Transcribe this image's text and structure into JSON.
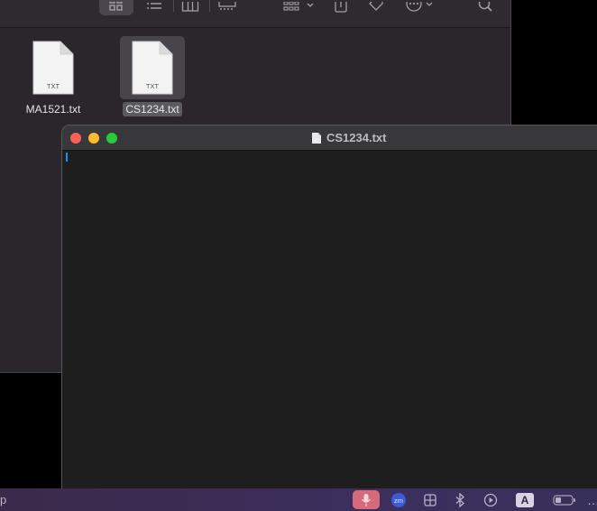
{
  "finder": {
    "toolbar_icons": [
      "icon-view-icon",
      "list-view-icon",
      "column-view-icon",
      "gallery-view-icon",
      "group-icon",
      "share-icon",
      "tag-icon",
      "more-icon",
      "search-icon"
    ],
    "files": [
      {
        "name": "MA1521.txt",
        "badge": "TXT",
        "selected": false
      },
      {
        "name": "CS1234.txt",
        "badge": "TXT",
        "selected": true
      }
    ]
  },
  "editor": {
    "title": "CS1234.txt",
    "content": ""
  },
  "bottom_bar": {
    "left_text": "p",
    "zoom_label": "zm",
    "input_label": "A",
    "icons": [
      "microphone-icon",
      "zoom-icon",
      "display-icon",
      "bluetooth-icon",
      "play-icon",
      "input-source-icon",
      "battery-icon"
    ]
  },
  "colors": {
    "accent": "#1f8bff",
    "close": "#fe5f57",
    "minimize": "#febc2e",
    "zoom": "#28c840",
    "mic_active": "#d66a7a"
  }
}
